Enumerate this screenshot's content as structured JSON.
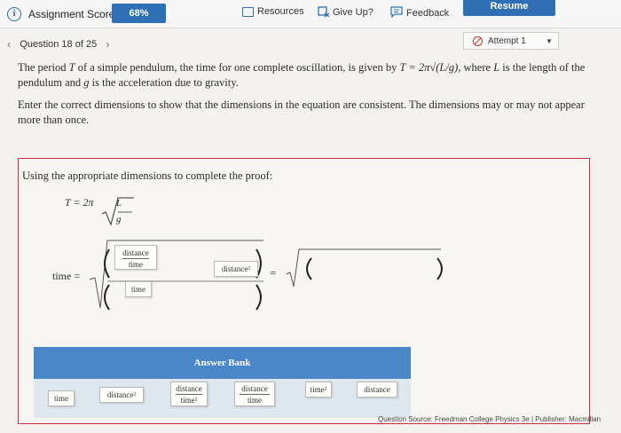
{
  "topbar": {
    "score_label": "Assignment Score:",
    "score_value": "68%",
    "resources": "Resources",
    "give_up": "Give Up?",
    "feedback": "Feedback",
    "resume": "Resume",
    "accent": "#2f6fb3"
  },
  "nav": {
    "question": "Question 18 of 25",
    "attempt": "Attempt 1"
  },
  "question": {
    "p1_a": "The period ",
    "p1_T": "T",
    "p1_b": " of a simple pendulum, the time for one complete oscillation, is given by ",
    "p1_formula": "T = 2π√(L/g)",
    "p1_c": ", where ",
    "p1_L": "L",
    "p1_d": " is the length of the pendulum and ",
    "p1_g": "g",
    "p1_e": " is the acceleration due to gravity.",
    "p2": "Enter the correct dimensions to show that the dimensions in the equation are consistent. The dimensions may or may not appear more than once."
  },
  "proof": {
    "title": "Using the appropriate dimensions to complete the proof:",
    "formula_left": "T = 2π",
    "frac_num": "L",
    "frac_den": "g",
    "time_label": "time =",
    "equals": "=",
    "slot_num": {
      "num": "distance",
      "den": "time"
    },
    "slot_den": "time",
    "slot_right": "distance²"
  },
  "bank": {
    "header": "Answer Bank",
    "items": [
      {
        "label": "time"
      },
      {
        "label": "distance²"
      },
      {
        "num": "distance",
        "den": "time²"
      },
      {
        "num": "distance",
        "den": "time"
      },
      {
        "label": "time²"
      },
      {
        "label": "distance"
      }
    ]
  },
  "footer": {
    "source": "Question Source: Freedman College Physics 3e  |  Publisher: Macmillan"
  }
}
